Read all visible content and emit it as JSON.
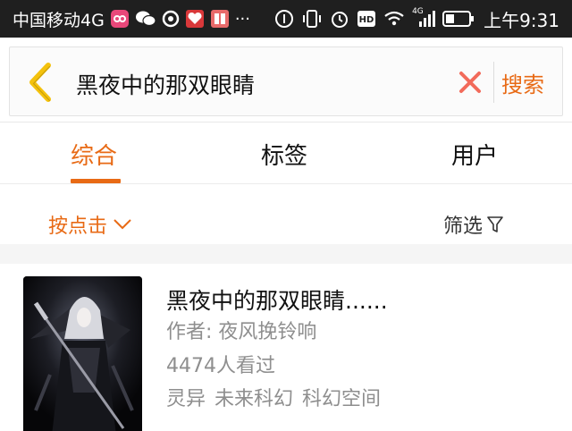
{
  "status_bar": {
    "carrier": "中国移动4G",
    "time": "上午9:31",
    "network_type": "4G",
    "more": "···",
    "icons": [
      "notification-badge-icon",
      "wechat-icon",
      "chat-icon",
      "app-icon",
      "reader-icon",
      "more-icon",
      "data-saver-icon",
      "vibrate-icon",
      "alarm-icon",
      "hd-icon",
      "wifi-icon",
      "signal-icon",
      "battery-icon"
    ]
  },
  "search": {
    "query": "黑夜中的那双眼睛",
    "submit_label": "搜索",
    "accent_color": "#e86a15"
  },
  "tabs": [
    {
      "label": "综合",
      "active": true
    },
    {
      "label": "标签",
      "active": false
    },
    {
      "label": "用户",
      "active": false
    }
  ],
  "filters": {
    "sort_label": "按点击",
    "filter_label": "筛选"
  },
  "results": [
    {
      "title": "黑夜中的那双眼睛......",
      "author_prefix": "作者:",
      "author": "夜风挽铃响",
      "views": "4474人看过",
      "tags": [
        "灵异",
        "未来科幻",
        "科幻空间"
      ]
    }
  ]
}
